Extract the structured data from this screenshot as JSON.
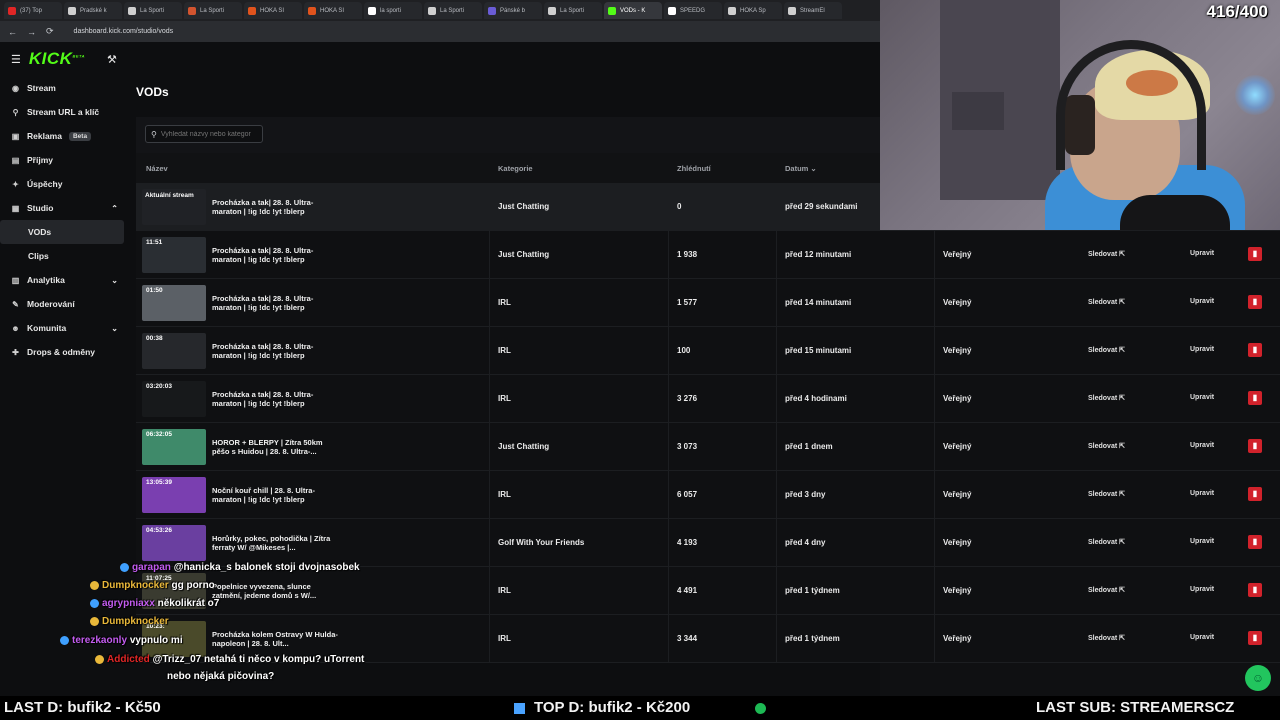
{
  "browser": {
    "tabs": [
      {
        "label": "(37) Top",
        "color": "#e02626"
      },
      {
        "label": "Pradské k",
        "color": "#cfcfcf"
      },
      {
        "label": "La Sporti",
        "color": "#cfcfcf"
      },
      {
        "label": "La Sporti",
        "color": "#d2542f"
      },
      {
        "label": "HOKA SI",
        "color": "#e0531d"
      },
      {
        "label": "HOKA SI",
        "color": "#e0531d"
      },
      {
        "label": "la sporti",
        "color": "#ffffff"
      },
      {
        "label": "La Sporti",
        "color": "#cfcfcf"
      },
      {
        "label": "Pánské b",
        "color": "#6a5cd6"
      },
      {
        "label": "La Sporti",
        "color": "#cfcfcf"
      },
      {
        "label": "VODs - K",
        "color": "#53fc18"
      },
      {
        "label": "SPEEDG",
        "color": "#ffffff"
      },
      {
        "label": "HOKA Sp",
        "color": "#cfcfcf"
      },
      {
        "label": "StreamEl",
        "color": "#cfcfcf"
      }
    ],
    "active_tab": 10,
    "url": "dashboard.kick.com/studio/vods",
    "nav": {
      "back": "←",
      "forward": "→",
      "reload": "⟳"
    }
  },
  "brand": {
    "logo": "KICK",
    "logo_sup": "BETA",
    "accent": "#53fc18"
  },
  "sidebar": {
    "items": [
      {
        "label": "Stream",
        "icon": "broadcast-icon",
        "glyph": "◉"
      },
      {
        "label": "Stream URL a klíč",
        "icon": "link-icon",
        "glyph": "⚲"
      },
      {
        "label": "Reklama",
        "icon": "ad-icon",
        "glyph": "▣",
        "badge": "Beta"
      },
      {
        "label": "Příjmy",
        "icon": "wallet-icon",
        "glyph": "▤"
      },
      {
        "label": "Úspěchy",
        "icon": "trophy-icon",
        "glyph": "✦"
      },
      {
        "label": "Studio",
        "icon": "studio-icon",
        "glyph": "▦",
        "chevron": "⌃"
      }
    ],
    "studio_children": [
      {
        "label": "VODs",
        "selected": true
      },
      {
        "label": "Clips",
        "selected": false
      }
    ],
    "items_after": [
      {
        "label": "Analytika",
        "icon": "chart-icon",
        "glyph": "▥",
        "chevron": "⌄"
      },
      {
        "label": "Moderování",
        "icon": "wrench-icon",
        "glyph": "✎"
      },
      {
        "label": "Komunita",
        "icon": "people-icon",
        "glyph": "☻",
        "chevron": "⌄"
      },
      {
        "label": "Drops & odměny",
        "icon": "gift-icon",
        "glyph": "✚"
      }
    ]
  },
  "page": {
    "title": "VODs",
    "search_placeholder": "Vyhledat názvy nebo kategor",
    "columns": {
      "name": "Název",
      "category": "Kategorie",
      "views": "Zhlédnutí",
      "date": "Datum ⌄"
    }
  },
  "vods": [
    {
      "duration": "Aktuální stream",
      "current": true,
      "title": "Procházka a tak| 28. 8. Ultra-maraton | !ig !dc !yt !blerp",
      "category": "Just Chatting",
      "views": "0",
      "date": "před 29 sekundami",
      "visibility": "",
      "watch": "",
      "edit": "",
      "thumb": "#202226"
    },
    {
      "duration": "11:51",
      "title": "Procházka a tak| 28. 8. Ultra-maraton | !ig !dc !yt !blerp",
      "category": "Just Chatting",
      "views": "1 938",
      "date": "před 12 minutami",
      "visibility": "Veřejný",
      "watch": "Sledovat ⇱",
      "edit": "Upravit",
      "thumb": "#2a2e33"
    },
    {
      "duration": "01:50",
      "title": "Procházka a tak| 28. 8. Ultra-maraton | !ig !dc !yt !blerp",
      "category": "IRL",
      "views": "1 577",
      "date": "před 14 minutami",
      "visibility": "Veřejný",
      "watch": "Sledovat ⇱",
      "edit": "Upravit",
      "thumb": "#5b6066"
    },
    {
      "duration": "00:38",
      "title": "Procházka a tak| 28. 8. Ultra-maraton | !ig !dc !yt !blerp",
      "category": "IRL",
      "views": "100",
      "date": "před 15 minutami",
      "visibility": "Veřejný",
      "watch": "Sledovat ⇱",
      "edit": "Upravit",
      "thumb": "#26282c"
    },
    {
      "duration": "03:20:03",
      "title": "Procházka a tak| 28. 8. Ultra-maraton | !ig !dc !yt !blerp",
      "category": "IRL",
      "views": "3 276",
      "date": "před 4 hodinami",
      "visibility": "Veřejný",
      "watch": "Sledovat ⇱",
      "edit": "Upravit",
      "thumb": "#17191b"
    },
    {
      "duration": "06:32:05",
      "title": "HOROR + BLERPY | Zítra 50km pěšo s Huidou | 28. 8. Ultra-...",
      "category": "Just Chatting",
      "views": "3 073",
      "date": "před 1 dnem",
      "visibility": "Veřejný",
      "watch": "Sledovat ⇱",
      "edit": "Upravit",
      "thumb": "#3f8a6a"
    },
    {
      "duration": "13:05:39",
      "title": "Noční kouř chill | 28. 8. Ultra-maraton | !ig !dc !yt !blerp",
      "category": "IRL",
      "views": "6 057",
      "date": "před 3 dny",
      "visibility": "Veřejný",
      "watch": "Sledovat ⇱",
      "edit": "Upravit",
      "thumb": "#7a3fb0"
    },
    {
      "duration": "04:53:26",
      "title": "Horůrky, pokec, pohodička | Zítra ferraty W/ @Mikeses |...",
      "category": "Golf With Your Friends",
      "views": "4 193",
      "date": "před 4 dny",
      "visibility": "Veřejný",
      "watch": "Sledovat ⇱",
      "edit": "Upravit",
      "thumb": "#6a3fa0"
    },
    {
      "duration": "11:07:25",
      "title": "Popelnice vyvezena, slunce zatmění, jedeme domů s W/...",
      "category": "IRL",
      "views": "4 491",
      "date": "před 1 týdnem",
      "visibility": "Veřejný",
      "watch": "Sledovat ⇱",
      "edit": "Upravit",
      "thumb": "#3a3b30"
    },
    {
      "duration": "10:23:",
      "title": "Procházka kolem Ostravy W Hulda-napoleon | 28. 8. Ult...",
      "category": "IRL",
      "views": "3 344",
      "date": "před 1 týdnem",
      "visibility": "Veřejný",
      "watch": "Sledovat ⇱",
      "edit": "Upravit",
      "thumb": "#4a4a2a"
    }
  ],
  "overlay": {
    "counter": "416/400",
    "chat": [
      {
        "user": "garapan",
        "user_color": "#c35cf0",
        "message": "@hanicka_s balonek stoji dvojnasobek"
      },
      {
        "user": "Dumpknocker",
        "user_color": "#e9b83a",
        "message": "gg porno"
      },
      {
        "user": "agrypniaxx",
        "user_color": "#c35cf0",
        "message": "několikrát o7"
      },
      {
        "user": "Dumpknocker",
        "user_color": "#e9b83a",
        "message": ""
      },
      {
        "user": "terezkaonly",
        "user_color": "#c35cf0",
        "message": "vypnulo mi"
      },
      {
        "user": "Addicted",
        "user_color": "#e02626",
        "message": "@Trizz_07 netahá ti něco v kompu? uTorrent"
      },
      {
        "user": "",
        "user_color": "#ffffff",
        "message": "nebo nějaká pičovina?"
      }
    ],
    "ticker": {
      "last_donation": "LAST D: bufik2 - Kč50",
      "top_donation": "TOP D: bufik2 - Kč200",
      "last_sub": "LAST SUB: STREAMERSCZ"
    }
  }
}
